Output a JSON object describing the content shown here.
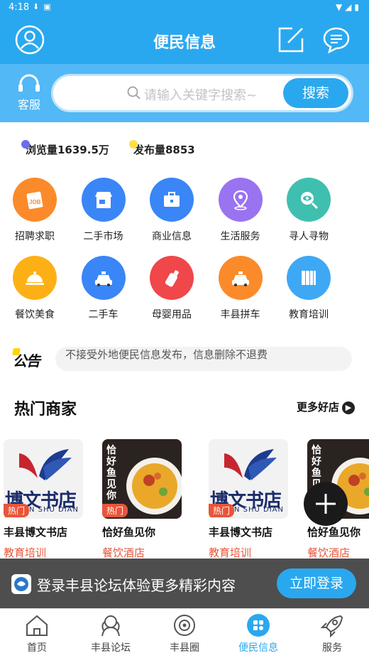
{
  "status": {
    "time": "4:18"
  },
  "header": {
    "title": "便民信息",
    "user_icon": "user-icon",
    "edit_icon": "edit-icon",
    "message_icon": "chat-icon"
  },
  "search": {
    "service_label": "客服",
    "placeholder": "请输入关键字搜索~",
    "button": "搜索"
  },
  "stats": {
    "views": "浏览量1639.5万",
    "posts": "发布量8853"
  },
  "categories": [
    {
      "label": "招聘求职",
      "color": "#fb8b2a",
      "icon": "job-icon"
    },
    {
      "label": "二手市场",
      "color": "#3a86f7",
      "icon": "store-icon"
    },
    {
      "label": "商业信息",
      "color": "#3a86f7",
      "icon": "briefcase-icon"
    },
    {
      "label": "生活服务",
      "color": "#9a73f0",
      "icon": "location-icon"
    },
    {
      "label": "寻人寻物",
      "color": "#3fbfb0",
      "icon": "eye-search-icon"
    },
    {
      "label": "餐饮美食",
      "color": "#fdb016",
      "icon": "dish-icon"
    },
    {
      "label": "二手车",
      "color": "#3a86f7",
      "icon": "taxi-icon"
    },
    {
      "label": "母婴用品",
      "color": "#f0474b",
      "icon": "bottle-icon"
    },
    {
      "label": "丰县拼车",
      "color": "#fb8b2a",
      "icon": "taxi-icon"
    },
    {
      "label": "教育培训",
      "color": "#3ea8f5",
      "icon": "books-icon"
    }
  ],
  "notice": {
    "logo": "公告",
    "text": "不接受外地便民信息发布，信息删除不退费"
  },
  "section": {
    "title": "热门商家",
    "more": "更多好店"
  },
  "shops": [
    {
      "name": "丰县博文书店",
      "category": "教育培训",
      "badge": "热门",
      "logo_text": "博文书店",
      "logo_sub": "N SHU DIAN"
    },
    {
      "name": "恰好鱼见你",
      "category": "餐饮酒店",
      "badge": "热门",
      "logo_text": "恰好鱼见你"
    },
    {
      "name": "丰县博文书店",
      "category": "教育培训",
      "badge": "热门",
      "logo_text": "博文书店",
      "logo_sub": "N SHU DIAN"
    },
    {
      "name": "恰好鱼见你",
      "category": "餐饮酒店",
      "badge": "热门",
      "logo_text": "恰好鱼见你"
    }
  ],
  "login_banner": {
    "text": "登录丰县论坛体验更多精彩内容",
    "button": "立即登录"
  },
  "tabs": [
    {
      "label": "首页",
      "icon": "home-icon",
      "active": false
    },
    {
      "label": "丰县论坛",
      "icon": "forum-icon",
      "active": false
    },
    {
      "label": "丰县圈",
      "icon": "circle-icon",
      "active": false
    },
    {
      "label": "便民信息",
      "icon": "grid-icon",
      "active": true
    },
    {
      "label": "服务",
      "icon": "rocket-icon",
      "active": false
    }
  ],
  "colors": {
    "primary": "#2aa8ef",
    "accent_red": "#e8553a"
  }
}
